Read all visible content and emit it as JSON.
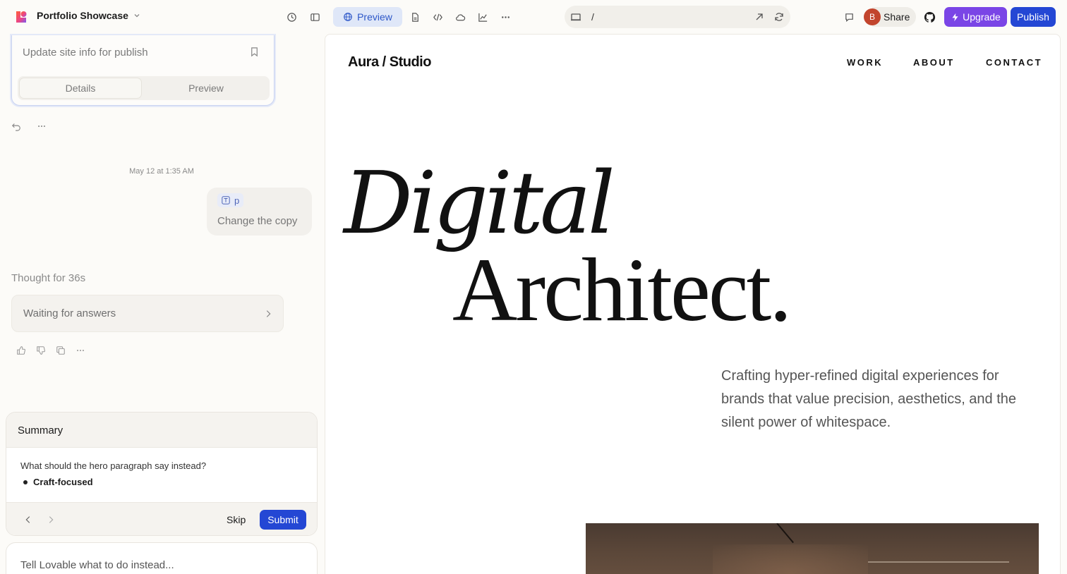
{
  "topbar": {
    "project_name": "Portfolio Showcase",
    "preview_label": "Preview",
    "url_path": "/",
    "avatar_initial": "B",
    "share_label": "Share",
    "upgrade_label": "Upgrade",
    "publish_label": "Publish",
    "colors": {
      "preview_accent": "#2d57c8",
      "upgrade": "#7a45e6",
      "publish": "#2447d4"
    }
  },
  "chat": {
    "task_title": "Update site info for publish",
    "segments": [
      "Details",
      "Preview"
    ],
    "timestamp": "May 12 at 1:35 AM",
    "user_message": {
      "chip_label": "p",
      "text": "Change the copy"
    },
    "thought": "Thought for 36s",
    "waiting_label": "Waiting for answers",
    "summary": {
      "title": "Summary",
      "question": "What should the hero paragraph say instead?",
      "answer": "Craft-focused",
      "skip_label": "Skip",
      "submit_label": "Submit"
    },
    "input_placeholder": "Tell Lovable what to do instead..."
  },
  "site": {
    "brand": "Aura / Studio",
    "nav": [
      "WORK",
      "ABOUT",
      "CONTACT"
    ],
    "hero_line1": "Digital",
    "hero_line2": "Architect.",
    "hero_paragraph": "Crafting hyper-refined digital experiences for brands that value precision, aesthetics, and the silent power of whitespace."
  }
}
